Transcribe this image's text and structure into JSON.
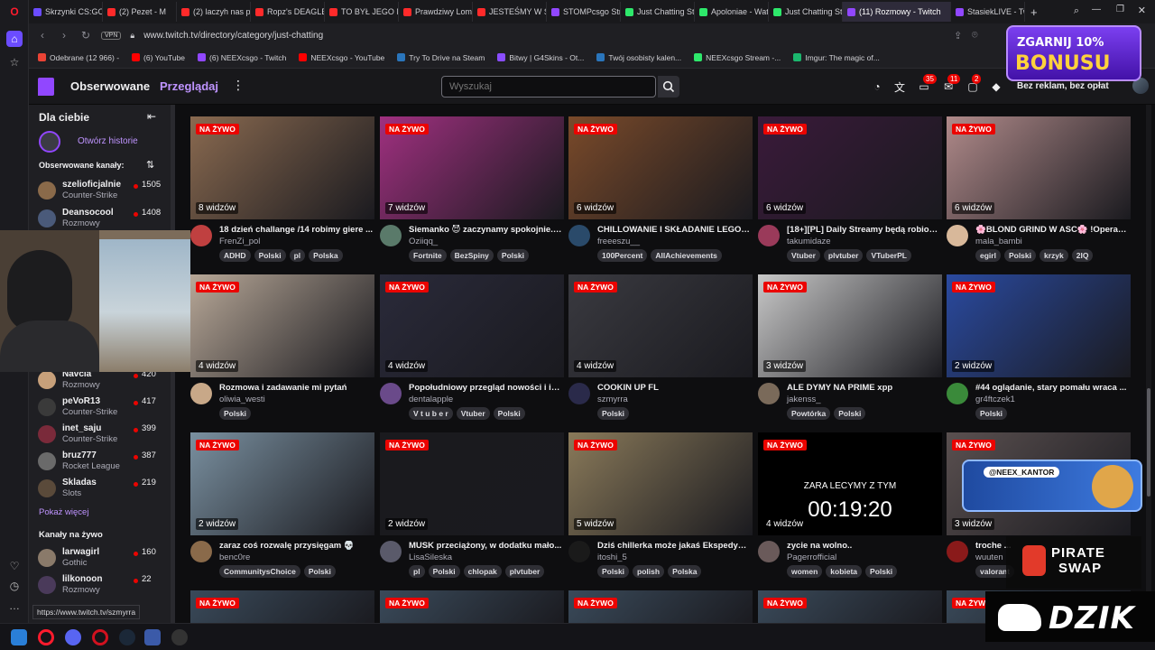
{
  "browser": {
    "tabs": [
      {
        "label": "Skrzynki CS:GO/",
        "color": "#6b4cff"
      },
      {
        "label": "(2) Pezet - M",
        "color": "#ff2a2a"
      },
      {
        "label": "(2) laczyh nas pi",
        "color": "#ff2a2a"
      },
      {
        "label": "Ropz's DEAGLE A",
        "color": "#ff2a2a"
      },
      {
        "label": "TO BYŁ JEGO NA",
        "color": "#ff2a2a"
      },
      {
        "label": "Prawdziwy Lomb",
        "color": "#ff2a2a"
      },
      {
        "label": "JESTEŚMY W SZW",
        "color": "#ff2a2a"
      },
      {
        "label": "STOMPcsgo Strea",
        "color": "#9147ff"
      },
      {
        "label": "Just Chatting Stre",
        "color": "#2ee86b"
      },
      {
        "label": "Apoloniae - Wat",
        "color": "#2ee86b"
      },
      {
        "label": "Just Chatting Stre",
        "color": "#2ee86b"
      },
      {
        "label": "(11) Rozmowy - Twitch",
        "color": "#9147ff"
      },
      {
        "label": "StasiekLIVE - Twi",
        "color": "#9147ff"
      }
    ],
    "new_tab": "+",
    "vpn": "VPN",
    "url": "www.twitch.tv/directory/category/just-chatting",
    "bookmarks": [
      {
        "label": "Odebrane (12 966) -",
        "color": "#ea4335"
      },
      {
        "label": "(6) YouTube",
        "color": "#ff0000"
      },
      {
        "label": "(6) NEEXcsgo - Twitch",
        "color": "#9147ff"
      },
      {
        "label": "NEEXcsgo - YouTube",
        "color": "#ff0000"
      },
      {
        "label": "Try To Drive na Steam",
        "color": "#2a75bb"
      },
      {
        "label": "Bitwy | G4Skins - Ot...",
        "color": "#8a4dff"
      },
      {
        "label": "Twój osobisty kalen...",
        "color": "#2a75bb"
      },
      {
        "label": "NEEXcsgo Stream -...",
        "color": "#2ee86b"
      },
      {
        "label": "Imgur: The magic of...",
        "color": "#1bb76e"
      }
    ],
    "status_url": "https://www.twitch.tv/szmyrra"
  },
  "topnav": {
    "following": "Obserwowane",
    "browse": "Przeglądaj",
    "more": "⋮",
    "search_placeholder": "Wyszukaj",
    "badges": {
      "inbox": "35",
      "notifications": "11",
      "whispers": "2"
    },
    "no_ads": "Bez reklam, bez opłat"
  },
  "sidebar": {
    "title": "Dla ciebie",
    "history": "Otwórz historie",
    "followed_heading": "Obserwowane kanały:",
    "followed": [
      {
        "name": "szelioficjalnie",
        "game": "Counter-Strike",
        "viewers": "1505",
        "color": "#8a6a4a"
      },
      {
        "name": "Deansocool",
        "game": "Rozmowy",
        "viewers": "1408",
        "color": "#4a5a7a"
      },
      {
        "name": "Navcia",
        "game": "Rozmowy",
        "viewers": "420",
        "color": "#c7a07a"
      },
      {
        "name": "peVoR13",
        "game": "Counter-Strike",
        "viewers": "417",
        "color": "#3a3a3a"
      },
      {
        "name": "inet_saju",
        "game": "Counter-Strike",
        "viewers": "399",
        "color": "#7a2a3a"
      },
      {
        "name": "bruz777",
        "game": "Rocket League",
        "viewers": "387",
        "color": "#6a6a6a"
      },
      {
        "name": "Skladas",
        "game": "Slots",
        "viewers": "219",
        "color": "#5a4a3a"
      }
    ],
    "show_more": "Pokaż więcej",
    "live_heading": "Kanały na żywo",
    "live": [
      {
        "name": "larwagirl",
        "game": "Gothic",
        "viewers": "160",
        "color": "#8a7a6a"
      },
      {
        "name": "lilkonoon",
        "game": "Rozmowy",
        "viewers": "22",
        "color": "#4a3a5a"
      }
    ]
  },
  "cards": [
    {
      "viewers": "8 widzów",
      "title": "18 dzień challange /14 robimy giere ...",
      "channel": "FrenZi_pol",
      "tags": [
        "ADHD",
        "Polski",
        "pl",
        "Polska"
      ],
      "color": "#8a6a50",
      "avatar": "#c04040"
    },
    {
      "viewers": "7 widzów",
      "title": "Siemanko 😈 zaczynamy spokojnie......",
      "channel": "Oziiqq_",
      "tags": [
        "Fortnite",
        "BezSpiny",
        "Polski"
      ],
      "color": "#a03080",
      "avatar": "#5a7a6a"
    },
    {
      "viewers": "6 widzów",
      "title": "CHILLOWANIE I SKŁADANIE LEGO O...",
      "channel": "freeeszu__",
      "tags": [
        "100Percent",
        "AllAchievements"
      ],
      "color": "#7a4a2a",
      "avatar": "#2a4a6a"
    },
    {
      "viewers": "6 widzów",
      "title": "[18+][PL] Daily Streamy będą robion...",
      "channel": "takumidaze",
      "tags": [
        "Vtuber",
        "plvtuber",
        "VTuberPL"
      ],
      "color": "#3a1a3a",
      "avatar": "#9a3a5a"
    },
    {
      "viewers": "6 widzów",
      "title": "🌸BLOND GRIND W ASC🌸 !OperaG...",
      "channel": "mala_bambi",
      "tags": [
        "egirl",
        "Polski",
        "krzyk",
        "2IQ"
      ],
      "color": "#b08a8a",
      "avatar": "#d8b89a"
    },
    {
      "viewers": "4 widzów",
      "title": "Rozmowa i zadawanie mi pytań",
      "channel": "oliwia_westi",
      "tags": [
        "Polski"
      ],
      "color": "#b8a898",
      "avatar": "#c8a888"
    },
    {
      "viewers": "4 widzów",
      "title": "Popołudniowy przegląd nowości i in...",
      "channel": "dentalapple",
      "tags": [
        "V t u b e r",
        "Vtuber",
        "Polski"
      ],
      "color": "#2a2a3a",
      "avatar": "#6a4a8a"
    },
    {
      "viewers": "4 widzów",
      "title": "COOKIN UP FL",
      "channel": "szmyrra",
      "tags": [
        "Polski"
      ],
      "color": "#3a3a40",
      "avatar": "#2a2a4a"
    },
    {
      "viewers": "3 widzów",
      "title": "ALE DYMY NA PRIME xpp",
      "channel": "jakenss_",
      "tags": [
        "Powtórka",
        "Polski"
      ],
      "color": "#c8c8c8",
      "avatar": "#7a6a5a"
    },
    {
      "viewers": "2 widzów",
      "title": "#44 oglądanie, stary pomału wraca ...",
      "channel": "gr4ftczek1",
      "tags": [
        "Polski"
      ],
      "color": "#2a4aa0",
      "avatar": "#3a8a3a"
    },
    {
      "viewers": "2 widzów",
      "title": "zaraz coś rozwalę przysięgam 💀",
      "channel": "benc0re",
      "tags": [
        "CommunitysChoice",
        "Polski"
      ],
      "color": "#7a90a0",
      "avatar": "#8a6a4a"
    },
    {
      "viewers": "2 widzów",
      "title": "MUSK przeciążony, w dodatku mało...",
      "channel": "LisaSileska",
      "tags": [
        "pl",
        "Polski",
        "chlopak",
        "plvtuber"
      ],
      "color": "#1a1a1e",
      "avatar": "#5a5a6a"
    },
    {
      "viewers": "5 widzów",
      "title": "Dziś chillerka może jakaś Ekspedycj...",
      "channel": "itoshi_5",
      "tags": [
        "Polski",
        "polish",
        "Polska"
      ],
      "color": "#8a7a5a",
      "avatar": "#1a1a1a"
    },
    {
      "viewers": "4 widzów",
      "title": "zycie na wolno..",
      "channel": "Pagerrofficial",
      "tags": [
        "women",
        "kobieta",
        "Polski"
      ],
      "color": "#000000",
      "avatar": "#6a5a5a",
      "overlay_text": "ZARA LECYMY Z TYM",
      "timer": "00:19:20"
    },
    {
      "viewers": "3 widzów",
      "title": "troche ...",
      "channel": "wuuten",
      "tags": [
        "valorant"
      ],
      "color": "#5a5050",
      "avatar": "#8a1a1a"
    }
  ],
  "row4_live": [
    "NA ŻYWO",
    "NA ŻYWO",
    "NA ŻYWO",
    "NA ŻYWO",
    "NA ŻYWO"
  ],
  "live_label": "NA ŻYWO",
  "promo": {
    "line1": "ZGARNIJ 10%",
    "line2": "BONUSU"
  },
  "kantor": {
    "handle": "@NEEX_KANTOR"
  },
  "pirate": {
    "line1": "PIRATE",
    "line2": "SWAP"
  },
  "dzik": "DZIK"
}
